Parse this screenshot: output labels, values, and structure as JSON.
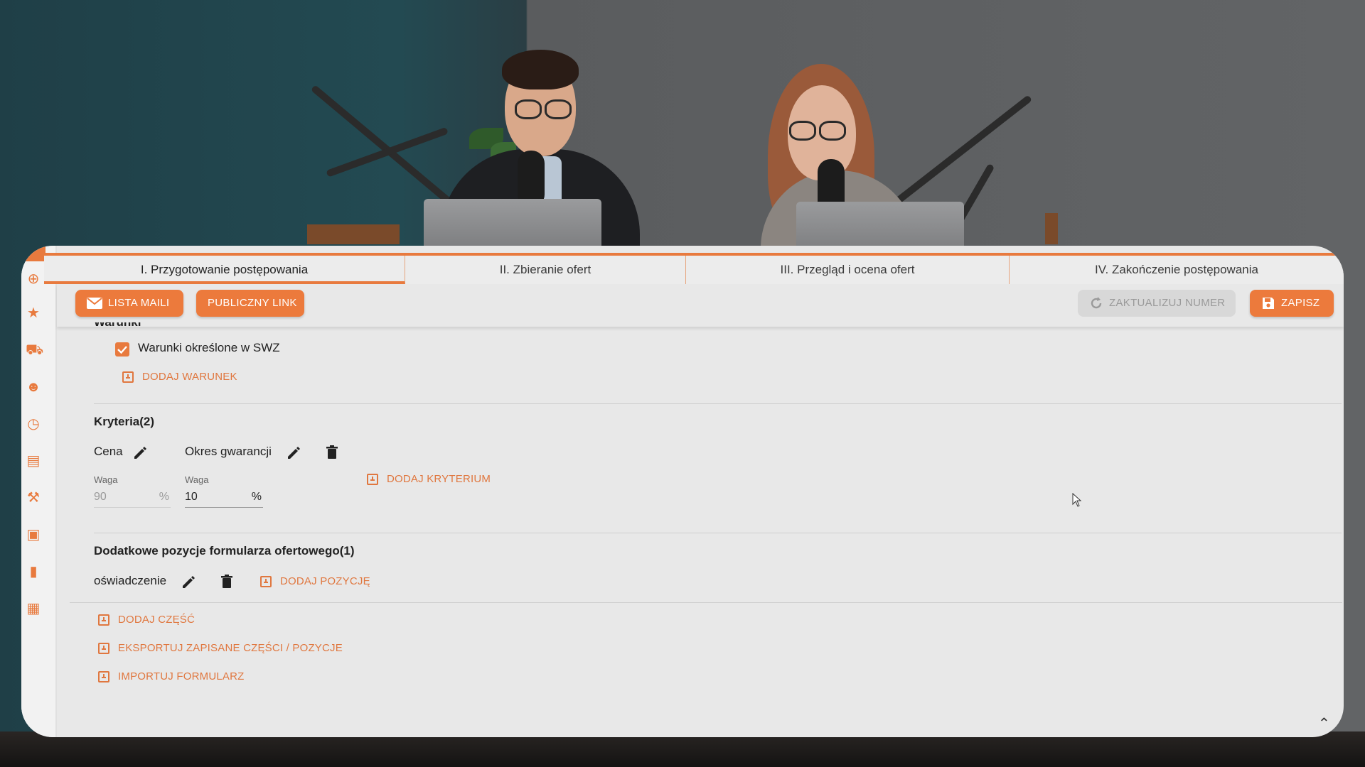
{
  "tabs": [
    {
      "label": "I. Przygotowanie postępowania",
      "active": true
    },
    {
      "label": "II. Zbieranie ofert",
      "active": false
    },
    {
      "label": "III. Przegląd i ocena ofert",
      "active": false
    },
    {
      "label": "IV. Zakończenie postępowania",
      "active": false
    }
  ],
  "toolbar": {
    "email_list_label": "LISTA MAILI",
    "public_link_label": "PUBLICZNY LINK",
    "update_number_label": "ZAKTUALIZUJ NUMER",
    "save_label": "ZAPISZ"
  },
  "conditions": {
    "title_partial": "Warunki",
    "checkbox_label": "Warunki określone w SWZ",
    "checked": true,
    "add_label": "DODAJ WARUNEK"
  },
  "criteria": {
    "title": "Kryteria(2)",
    "items": [
      {
        "name": "Cena",
        "weight_label": "Waga",
        "weight": "90",
        "unit": "%",
        "disabled": true
      },
      {
        "name": "Okres gwarancji",
        "weight_label": "Waga",
        "weight": "10",
        "unit": "%",
        "disabled": false
      }
    ],
    "add_label": "DODAJ KRYTERIUM"
  },
  "extra_positions": {
    "title": "Dodatkowe pozycje formularza ofertowego(1)",
    "items": [
      {
        "name": "oświadczenie"
      }
    ],
    "add_label": "DODAJ POZYCJĘ"
  },
  "actions": {
    "add_part": "DODAJ CZĘŚĆ",
    "export": "EKSPORTUJ ZAPISANE CZĘŚCI / POZYCJE",
    "import": "IMPORTUJ FORMULARZ"
  },
  "colors": {
    "accent": "#e87a3e",
    "link": "#e0773f",
    "disabled": "#d8d8d8"
  }
}
